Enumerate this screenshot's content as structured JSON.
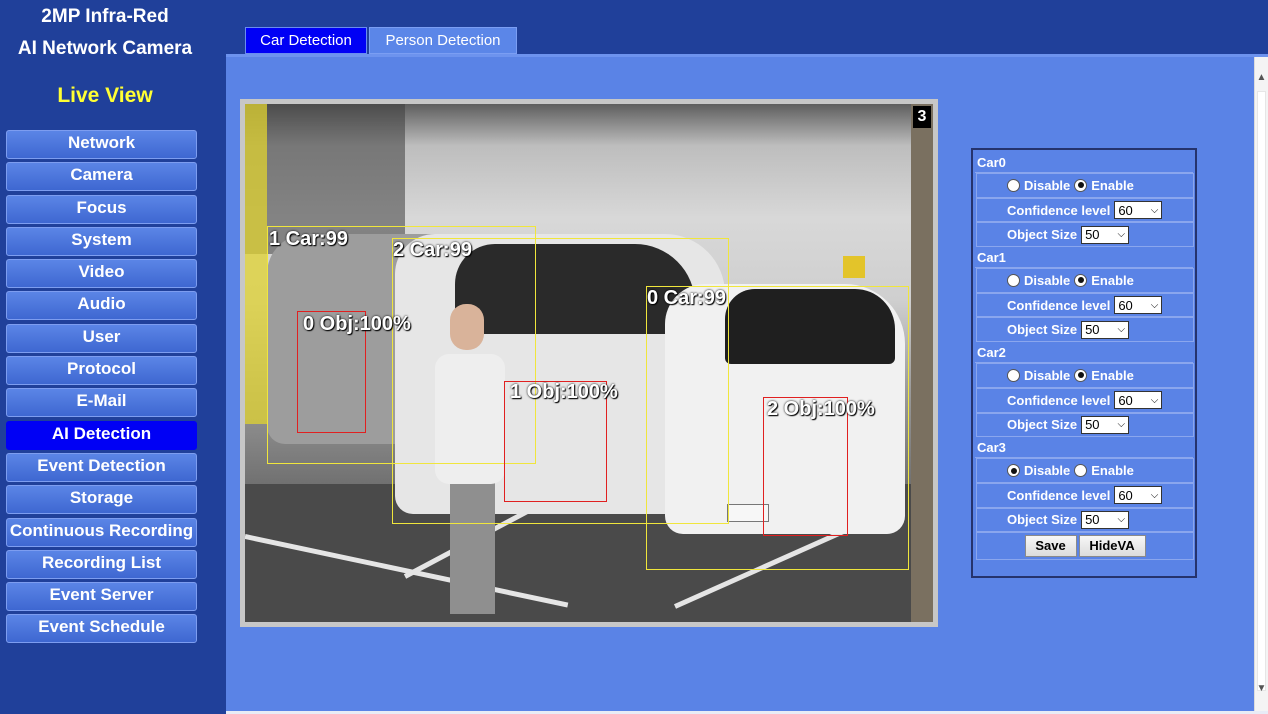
{
  "brand": {
    "line1": "2MP Infra-Red",
    "line2": "AI Network Camera"
  },
  "live_view": "Live View",
  "menu": [
    {
      "label": "Network",
      "active": false
    },
    {
      "label": "Camera",
      "active": false
    },
    {
      "label": "Focus",
      "active": false
    },
    {
      "label": "System",
      "active": false
    },
    {
      "label": "Video",
      "active": false
    },
    {
      "label": "Audio",
      "active": false
    },
    {
      "label": "User",
      "active": false
    },
    {
      "label": "Protocol",
      "active": false
    },
    {
      "label": "E-Mail",
      "active": false
    },
    {
      "label": "AI Detection",
      "active": true
    },
    {
      "label": "Event Detection",
      "active": false
    },
    {
      "label": "Storage",
      "active": false
    },
    {
      "label": "Continuous Recording",
      "active": false
    },
    {
      "label": "Recording List",
      "active": false
    },
    {
      "label": "Event Server",
      "active": false
    },
    {
      "label": "Event Schedule",
      "active": false
    }
  ],
  "tabs": {
    "car": "Car Detection",
    "person": "Person Detection",
    "active": "car"
  },
  "video": {
    "channel": "3",
    "car_labels": [
      "1 Car:99",
      "2 Car:99",
      "0 Car:99"
    ],
    "obj_labels": [
      "0 Obj:100%",
      "1 Obj:100%",
      "2 Obj:100%"
    ]
  },
  "settings": {
    "disable_label": "Disable",
    "enable_label": "Enable",
    "confidence_label": "Confidence level",
    "object_size_label": "Object Size",
    "cars": [
      {
        "name": "Car0",
        "mode": "enable",
        "confidence": "60",
        "size": "50"
      },
      {
        "name": "Car1",
        "mode": "enable",
        "confidence": "60",
        "size": "50"
      },
      {
        "name": "Car2",
        "mode": "enable",
        "confidence": "60",
        "size": "50"
      },
      {
        "name": "Car3",
        "mode": "disable",
        "confidence": "60",
        "size": "50"
      }
    ],
    "save": "Save",
    "hideva": "HideVA"
  },
  "colors": {
    "background": "#20409a",
    "panel": "#5a83e6",
    "active_blue": "#0000f5",
    "live_view_yellow": "#ffff33",
    "detection_box": "#f0e63c",
    "object_box": "#e02020"
  }
}
